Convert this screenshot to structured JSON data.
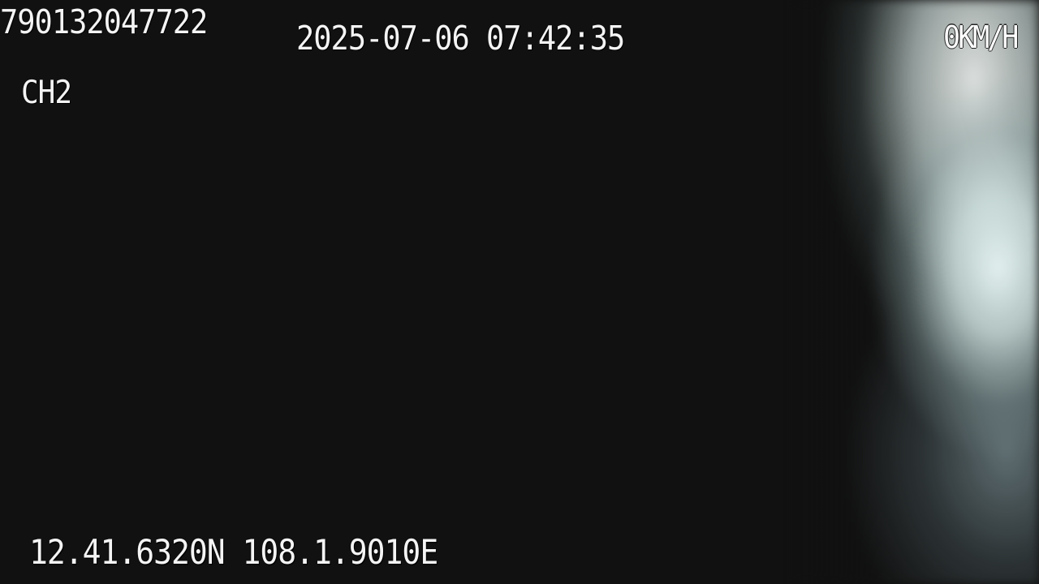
{
  "osd": {
    "device_id": "790132047722",
    "datetime": "2025-07-06 07:42:35",
    "channel": "CH2",
    "speed": "0KM/H",
    "gps": "12.41.6320N 108.1.9010E"
  }
}
